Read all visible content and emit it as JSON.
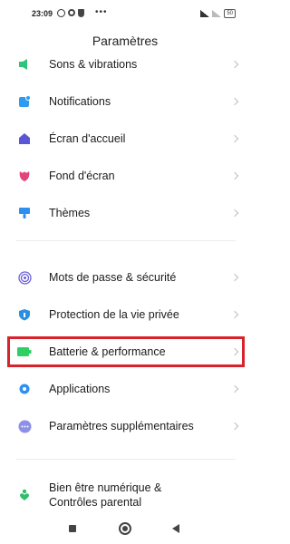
{
  "status_bar": {
    "time": "23:09",
    "battery": "50"
  },
  "header": {
    "title": "Paramètres"
  },
  "settings": {
    "items": [
      {
        "label": "Sons & vibrations",
        "icon": "sound-icon",
        "color": "#2fc47b"
      },
      {
        "label": "Notifications",
        "icon": "notifications-icon",
        "color": "#2f9bf0"
      },
      {
        "label": "Écran d'accueil",
        "icon": "home-screen-icon",
        "color": "#5c55d8"
      },
      {
        "label": "Fond d'écran",
        "icon": "wallpaper-icon",
        "color": "#e2457a"
      },
      {
        "label": "Thèmes",
        "icon": "themes-icon",
        "color": "#2f8ff0"
      },
      {
        "label": "Mots de passe & sécurité",
        "icon": "fingerprint-icon",
        "color": "#6a60d8"
      },
      {
        "label": "Protection de la vie privée",
        "icon": "privacy-shield-icon",
        "color": "#2b8fe0"
      },
      {
        "label": "Batterie & performance",
        "icon": "battery-icon",
        "color": "#2fcf66"
      },
      {
        "label": "Applications",
        "icon": "apps-gear-icon",
        "color": "#2d8ff0"
      },
      {
        "label": "Paramètres supplémentaires",
        "icon": "more-settings-icon",
        "color": "#8d8fe8"
      },
      {
        "label": "Bien être numérique &\nContrôles parental",
        "icon": "wellbeing-icon",
        "color": "#2fbf6a"
      }
    ]
  },
  "highlight": {
    "target": "Batterie & performance",
    "color": "#d8232a"
  }
}
